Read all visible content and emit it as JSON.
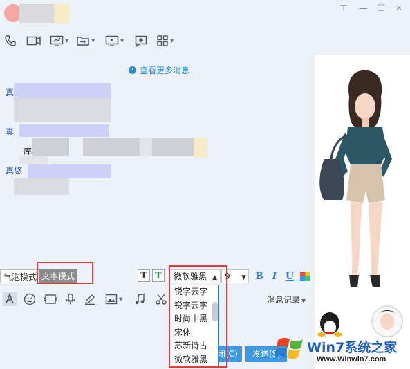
{
  "window": {
    "controls": {
      "pin": "⊤",
      "minimize": "—",
      "maximize": "☐",
      "close": "✕"
    }
  },
  "toolbar": {
    "icons": [
      "phone-icon",
      "video-icon",
      "screen-share-icon",
      "file-transfer-icon",
      "remote-desktop-icon",
      "add-app-icon",
      "apps-grid-icon"
    ]
  },
  "chat": {
    "more_messages": "查看更多消息",
    "senders": [
      "真",
      "真",
      "真悠"
    ],
    "fragment": "库"
  },
  "format_bar": {
    "bubble_mode": "气泡模式",
    "text_mode": "文本模式",
    "font_selected": "微软雅黑",
    "size_selected": "9",
    "bold": "B",
    "italic": "I",
    "underline": "U",
    "text_format_icon_1": "T",
    "text_format_icon_2": "T"
  },
  "font_dropdown": {
    "options": [
      "锐字云字",
      "锐字云字",
      "时尚中黑",
      "宋体",
      "苏新诗古",
      "微软雅黑"
    ]
  },
  "tools2": {
    "history_label": "消息记录",
    "icons": [
      "font-icon",
      "emoji-icon",
      "gif-icon",
      "mic-icon",
      "pen-icon",
      "image-icon",
      "music-icon",
      "scissors-icon"
    ]
  },
  "actions": {
    "close_label": "闭(C)",
    "send_label": "发送(S)"
  },
  "watermark": {
    "title": "Win7系统之家",
    "url": "Www.Winwin7.com"
  },
  "colors": {
    "accent": "#2f7fd6",
    "link": "#2a8fcf",
    "highlight_box": "#e03a3a",
    "send_button": "#3d99e6"
  }
}
